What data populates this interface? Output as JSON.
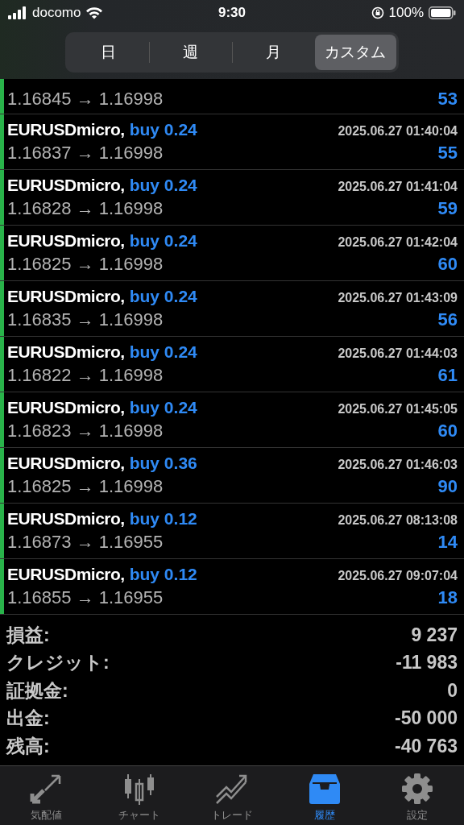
{
  "status_bar": {
    "carrier": "docomo",
    "time": "9:30",
    "battery": "100%"
  },
  "period_tabs": [
    {
      "label": "日",
      "selected": false
    },
    {
      "label": "週",
      "selected": false
    },
    {
      "label": "月",
      "selected": false
    },
    {
      "label": "カスタム",
      "selected": true
    }
  ],
  "deals": [
    {
      "prices": "1.16845 → 1.16998",
      "profit": "53"
    },
    {
      "symbol": "EURUSDmicro,",
      "side": "buy 0.24",
      "time": "2025.06.27 01:40:04",
      "prices": "1.16837 → 1.16998",
      "profit": "55"
    },
    {
      "symbol": "EURUSDmicro,",
      "side": "buy 0.24",
      "time": "2025.06.27 01:41:04",
      "prices": "1.16828 → 1.16998",
      "profit": "59"
    },
    {
      "symbol": "EURUSDmicro,",
      "side": "buy 0.24",
      "time": "2025.06.27 01:42:04",
      "prices": "1.16825 → 1.16998",
      "profit": "60"
    },
    {
      "symbol": "EURUSDmicro,",
      "side": "buy 0.24",
      "time": "2025.06.27 01:43:09",
      "prices": "1.16835 → 1.16998",
      "profit": "56"
    },
    {
      "symbol": "EURUSDmicro,",
      "side": "buy 0.24",
      "time": "2025.06.27 01:44:03",
      "prices": "1.16822 → 1.16998",
      "profit": "61"
    },
    {
      "symbol": "EURUSDmicro,",
      "side": "buy 0.24",
      "time": "2025.06.27 01:45:05",
      "prices": "1.16823 → 1.16998",
      "profit": "60"
    },
    {
      "symbol": "EURUSDmicro,",
      "side": "buy 0.36",
      "time": "2025.06.27 01:46:03",
      "prices": "1.16825 → 1.16998",
      "profit": "90"
    },
    {
      "symbol": "EURUSDmicro,",
      "side": "buy 0.12",
      "time": "2025.06.27 08:13:08",
      "prices": "1.16873 → 1.16955",
      "profit": "14"
    },
    {
      "symbol": "EURUSDmicro,",
      "side": "buy 0.12",
      "time": "2025.06.27 09:07:04",
      "prices": "1.16855 → 1.16955",
      "profit": "18"
    }
  ],
  "summary": [
    {
      "label": "損益:",
      "value": "9 237"
    },
    {
      "label": "クレジット:",
      "value": "-11 983"
    },
    {
      "label": "証拠金:",
      "value": "0"
    },
    {
      "label": "出金:",
      "value": "-50 000"
    },
    {
      "label": "残高:",
      "value": "-40 763"
    }
  ],
  "tab_bar": [
    {
      "kind": "quotes",
      "label": "気配値",
      "selected": false
    },
    {
      "kind": "chart",
      "label": "チャート",
      "selected": false
    },
    {
      "kind": "trade",
      "label": "トレード",
      "selected": false
    },
    {
      "kind": "history",
      "label": "履歴",
      "selected": true
    },
    {
      "kind": "settings",
      "label": "設定",
      "selected": false
    }
  ]
}
